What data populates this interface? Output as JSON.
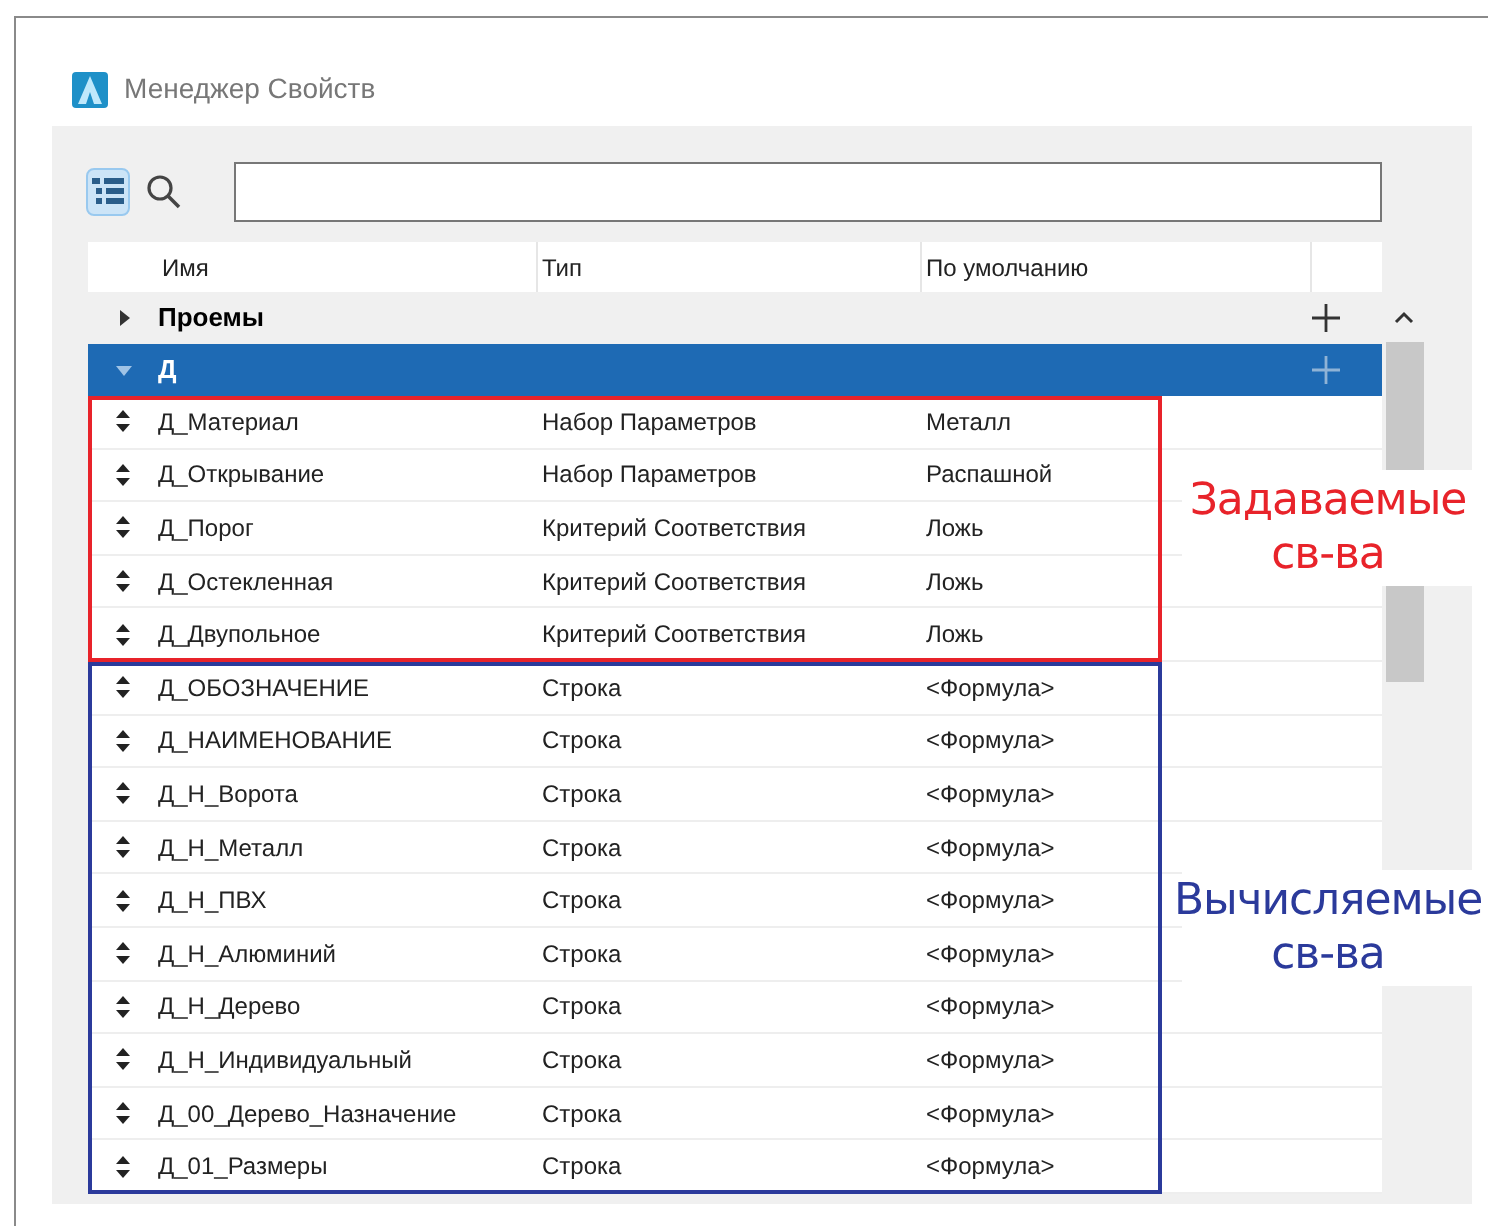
{
  "window": {
    "title": "Менеджер Свойств"
  },
  "toolbar": {
    "tree_view_selected": true
  },
  "table": {
    "columns": [
      "Имя",
      "Тип",
      "По умолчанию"
    ],
    "groups": [
      {
        "name": "Проемы",
        "expanded": false,
        "selected": false
      },
      {
        "name": "Д",
        "expanded": true,
        "selected": true,
        "sections": [
          {
            "color": "#e8232a",
            "note": [
              "Задаваемые",
              "св-ва"
            ],
            "rows": [
              {
                "name": "Д_Материал",
                "type": "Набор Параметров",
                "default": "Металл"
              },
              {
                "name": "Д_Открывание",
                "type": "Набор Параметров",
                "default": "Распашной"
              },
              {
                "name": "Д_Порог",
                "type": "Критерий Соответствия",
                "default": "Ложь"
              },
              {
                "name": "Д_Остекленная",
                "type": "Критерий Соответствия",
                "default": "Ложь"
              },
              {
                "name": "Д_Двупольное",
                "type": "Критерий Соответствия",
                "default": "Ложь"
              }
            ]
          },
          {
            "color": "#2b3a9b",
            "note": [
              "Вычисляемые",
              "св-ва"
            ],
            "rows": [
              {
                "name": "Д_ОБОЗНАЧЕНИЕ",
                "type": "Строка",
                "default": "<Формула>"
              },
              {
                "name": "Д_НАИМЕНОВАНИЕ",
                "type": "Строка",
                "default": "<Формула>"
              },
              {
                "name": "Д_Н_Ворота",
                "type": "Строка",
                "default": "<Формула>"
              },
              {
                "name": "Д_Н_Металл",
                "type": "Строка",
                "default": "<Формула>"
              },
              {
                "name": "Д_Н_ПВХ",
                "type": "Строка",
                "default": "<Формула>"
              },
              {
                "name": "Д_Н_Алюминий",
                "type": "Строка",
                "default": "<Формула>"
              },
              {
                "name": "Д_Н_Дерево",
                "type": "Строка",
                "default": "<Формула>"
              },
              {
                "name": "Д_Н_Индивидуальный",
                "type": "Строка",
                "default": "<Формула>"
              },
              {
                "name": "Д_00_Дерево_Назначение",
                "type": "Строка",
                "default": "<Формула>"
              },
              {
                "name": "Д_01_Размеры",
                "type": "Строка",
                "default": "<Формула>"
              }
            ]
          }
        ]
      }
    ]
  }
}
